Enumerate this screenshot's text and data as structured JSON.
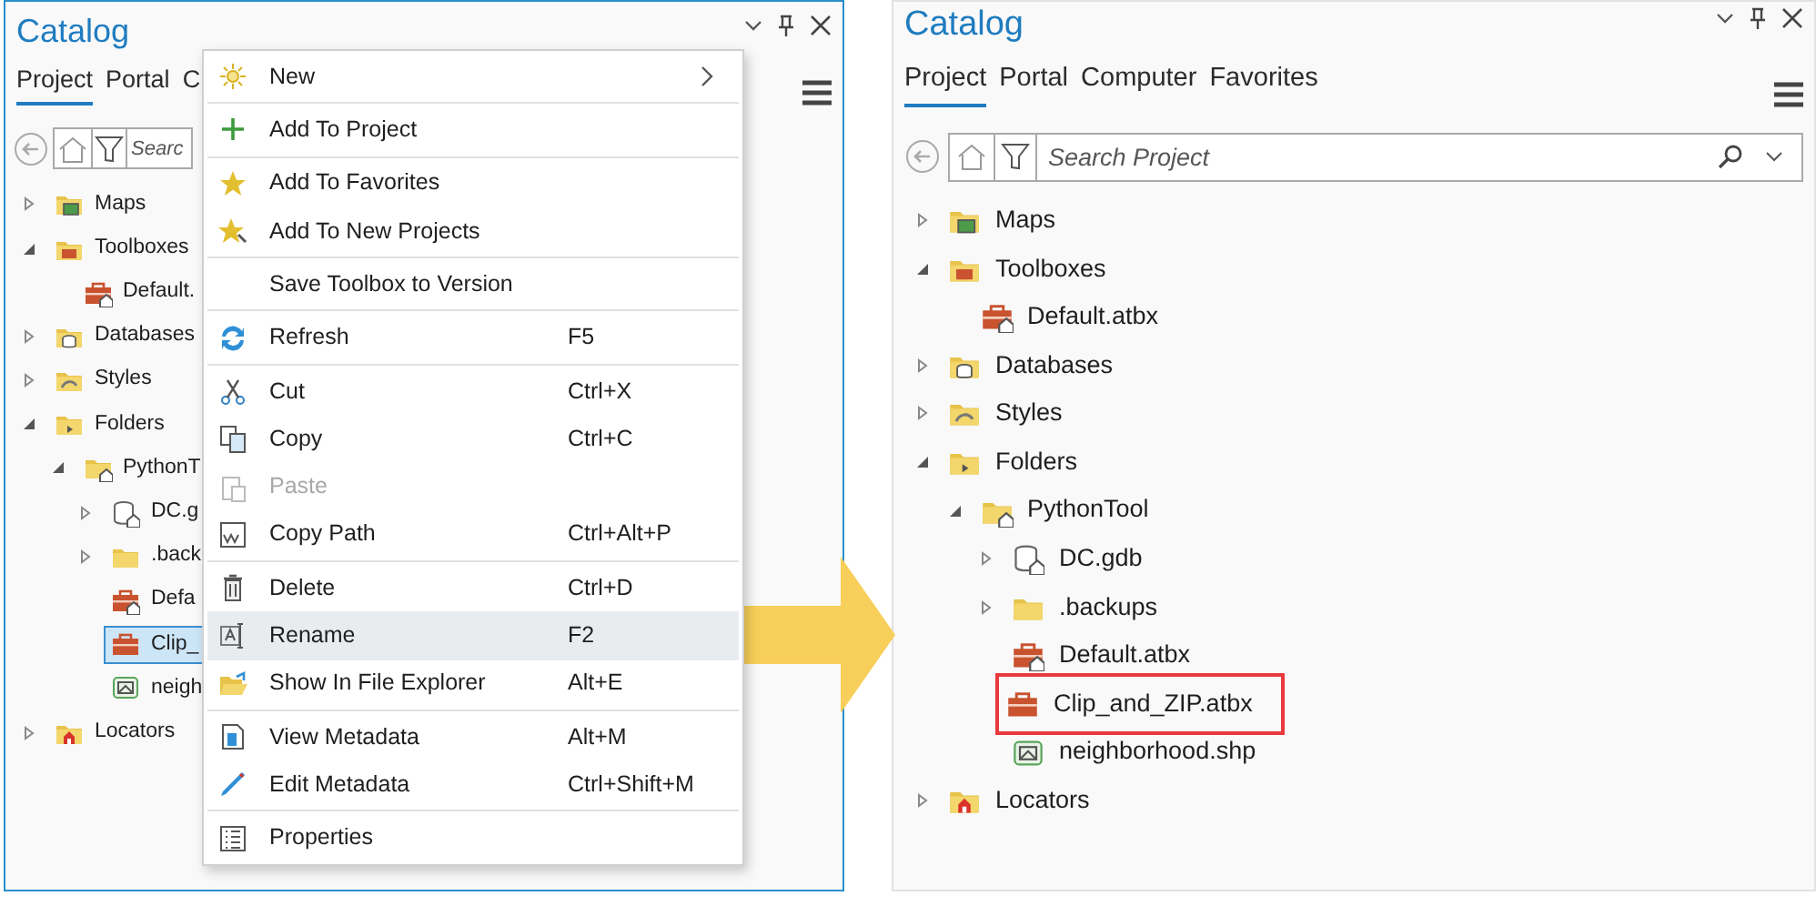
{
  "panels": [
    {
      "title": "Catalog",
      "active": true,
      "tabs": [
        {
          "label": "Project",
          "selected": true
        },
        {
          "label": "Portal",
          "selected": false
        },
        {
          "label": "C",
          "selected": false
        }
      ],
      "search": {
        "placeholder": "Searc"
      },
      "tree": [
        {
          "label": "Maps",
          "kind": "maps",
          "expanded": false,
          "selected": false
        },
        {
          "label": "Toolboxes",
          "kind": "toolboxes",
          "expanded": true,
          "selected": false,
          "children": [
            {
              "label": "Default.",
              "kind": "toolbox_home",
              "selected": false
            }
          ]
        },
        {
          "label": "Databases",
          "kind": "databases",
          "expanded": false,
          "selected": false
        },
        {
          "label": "Styles",
          "kind": "styles",
          "expanded": false,
          "selected": false
        },
        {
          "label": "Folders",
          "kind": "folders",
          "expanded": true,
          "selected": false,
          "children": [
            {
              "label": "PythonT",
              "kind": "home_folder",
              "expanded": true,
              "selected": false,
              "children": [
                {
                  "label": "DC.g",
                  "kind": "gdb_home",
                  "expanded": false,
                  "selected": false
                },
                {
                  "label": ".back",
                  "kind": "folder",
                  "expanded": false,
                  "selected": false
                },
                {
                  "label": "Defa",
                  "kind": "toolbox_home",
                  "selected": false
                },
                {
                  "label": "Clip_",
                  "kind": "toolbox",
                  "selected": true
                },
                {
                  "label": "neigh",
                  "kind": "shapefile",
                  "selected": false
                }
              ]
            }
          ]
        },
        {
          "label": "Locators",
          "kind": "locators",
          "expanded": false,
          "selected": false
        }
      ]
    },
    {
      "title": "Catalog",
      "active": false,
      "tabs": [
        {
          "label": "Project",
          "selected": true
        },
        {
          "label": "Portal",
          "selected": false
        },
        {
          "label": "Computer",
          "selected": false
        },
        {
          "label": "Favorites",
          "selected": false
        }
      ],
      "search": {
        "placeholder": "Search Project"
      },
      "tree": [
        {
          "label": "Maps",
          "kind": "maps",
          "expanded": false,
          "selected": false,
          "boxed": false
        },
        {
          "label": "Toolboxes",
          "kind": "toolboxes",
          "expanded": true,
          "selected": false,
          "boxed": false,
          "children": [
            {
              "label": "Default.atbx",
              "kind": "toolbox_home",
              "selected": false,
              "boxed": false
            }
          ]
        },
        {
          "label": "Databases",
          "kind": "databases",
          "expanded": false,
          "selected": false,
          "boxed": false
        },
        {
          "label": "Styles",
          "kind": "styles",
          "expanded": false,
          "selected": false,
          "boxed": false
        },
        {
          "label": "Folders",
          "kind": "folders",
          "expanded": true,
          "selected": false,
          "boxed": false,
          "children": [
            {
              "label": "PythonTool",
              "kind": "home_folder",
              "expanded": true,
              "selected": false,
              "boxed": false,
              "children": [
                {
                  "label": "DC.gdb",
                  "kind": "gdb_home",
                  "expanded": false,
                  "selected": false,
                  "boxed": false
                },
                {
                  "label": ".backups",
                  "kind": "folder",
                  "expanded": false,
                  "selected": false,
                  "boxed": false
                },
                {
                  "label": "Default.atbx",
                  "kind": "toolbox_home",
                  "selected": false,
                  "boxed": false
                },
                {
                  "label": "Clip_and_ZIP.atbx",
                  "kind": "toolbox",
                  "selected": false,
                  "boxed": true
                },
                {
                  "label": "neighborhood.shp",
                  "kind": "shapefile",
                  "selected": false,
                  "boxed": false
                }
              ]
            }
          ]
        },
        {
          "label": "Locators",
          "kind": "locators",
          "expanded": false,
          "selected": false,
          "boxed": false
        }
      ]
    }
  ],
  "context_menu": {
    "groups": [
      [
        {
          "label": "New",
          "kind": "sun",
          "submenu": true,
          "disabled": false,
          "selected": false
        }
      ],
      [
        {
          "label": "Add To Project",
          "kind": "plus",
          "disabled": false,
          "selected": false
        }
      ],
      [
        {
          "label": "Add To Favorites",
          "kind": "star",
          "disabled": false,
          "selected": false
        },
        {
          "label": "Add To New Projects",
          "kind": "star_pin",
          "disabled": false,
          "selected": false
        }
      ],
      [
        {
          "label": "Save Toolbox to Version",
          "kind": "none",
          "disabled": false,
          "selected": false
        }
      ],
      [
        {
          "label": "Refresh",
          "kind": "refresh",
          "shortcut": "F5",
          "disabled": false,
          "selected": false
        }
      ],
      [
        {
          "label": "Cut",
          "kind": "scissors",
          "shortcut": "Ctrl+X",
          "disabled": false,
          "selected": false
        },
        {
          "label": "Copy",
          "kind": "copy",
          "shortcut": "Ctrl+C",
          "disabled": false,
          "selected": false
        },
        {
          "label": "Paste",
          "kind": "paste",
          "disabled": true,
          "selected": false
        },
        {
          "label": "Copy Path",
          "kind": "copy_path",
          "shortcut": "Ctrl+Alt+P",
          "disabled": false,
          "selected": false
        }
      ],
      [
        {
          "label": "Delete",
          "kind": "trash",
          "shortcut": "Ctrl+D",
          "disabled": false,
          "selected": false
        },
        {
          "label": "Rename",
          "kind": "rename",
          "shortcut": "F2",
          "disabled": false,
          "selected": true
        },
        {
          "label": "Show In File Explorer",
          "kind": "folder_open",
          "shortcut": "Alt+E",
          "disabled": false,
          "selected": false
        }
      ],
      [
        {
          "label": "View Metadata",
          "kind": "document",
          "shortcut": "Alt+M",
          "disabled": false,
          "selected": false
        },
        {
          "label": "Edit Metadata",
          "kind": "pencil",
          "shortcut": "Ctrl+Shift+M",
          "disabled": false,
          "selected": false
        }
      ],
      [
        {
          "label": "Properties",
          "kind": "properties",
          "disabled": false,
          "selected": false
        }
      ]
    ]
  }
}
